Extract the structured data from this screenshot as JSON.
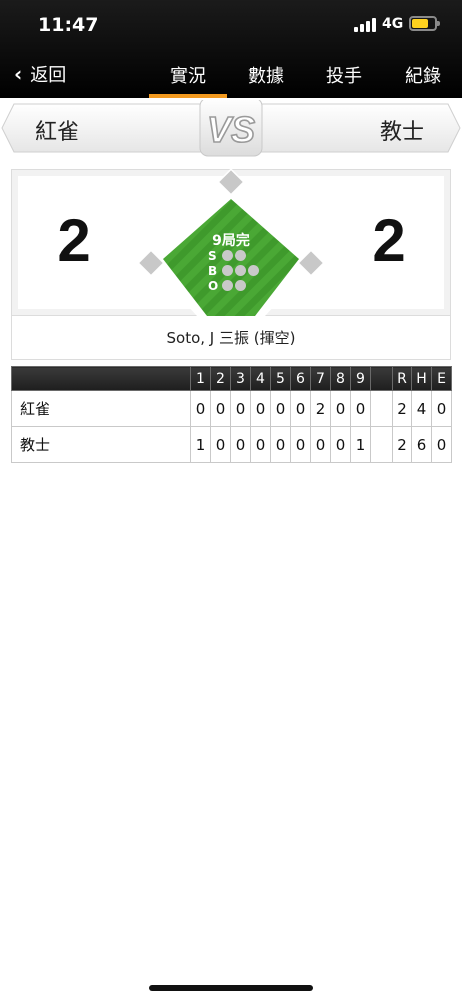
{
  "status_bar": {
    "time": "11:47",
    "network": "4G"
  },
  "nav": {
    "back_label": "返回",
    "tabs": [
      {
        "label": "實況",
        "active": true
      },
      {
        "label": "數據",
        "active": false
      },
      {
        "label": "投手",
        "active": false
      },
      {
        "label": "紀錄",
        "active": false
      }
    ]
  },
  "matchup": {
    "away_team": "紅雀",
    "home_team": "教士",
    "vs_label": "VS"
  },
  "scoreboard": {
    "away_score": "2",
    "home_score": "2",
    "inning_status": "9局完",
    "count_labels": [
      "S",
      "B",
      "O"
    ],
    "strikes_shown": 2,
    "balls_shown": 3,
    "outs_shown": 2
  },
  "last_play": "Soto, J 三振 (揮空)",
  "linescore": {
    "innings": [
      "1",
      "2",
      "3",
      "4",
      "5",
      "6",
      "7",
      "8",
      "9"
    ],
    "totals_headers": [
      "R",
      "H",
      "E"
    ],
    "rows": [
      {
        "team": "紅雀",
        "innings": [
          "0",
          "0",
          "0",
          "0",
          "0",
          "0",
          "2",
          "0",
          "0"
        ],
        "totals": [
          "2",
          "4",
          "0"
        ]
      },
      {
        "team": "教士",
        "innings": [
          "1",
          "0",
          "0",
          "0",
          "0",
          "0",
          "0",
          "0",
          "1"
        ],
        "totals": [
          "2",
          "6",
          "0"
        ]
      }
    ]
  },
  "colors": {
    "accent": "#f39a1f",
    "field_green": "#3f9a2c",
    "header_bg": "#000000"
  }
}
